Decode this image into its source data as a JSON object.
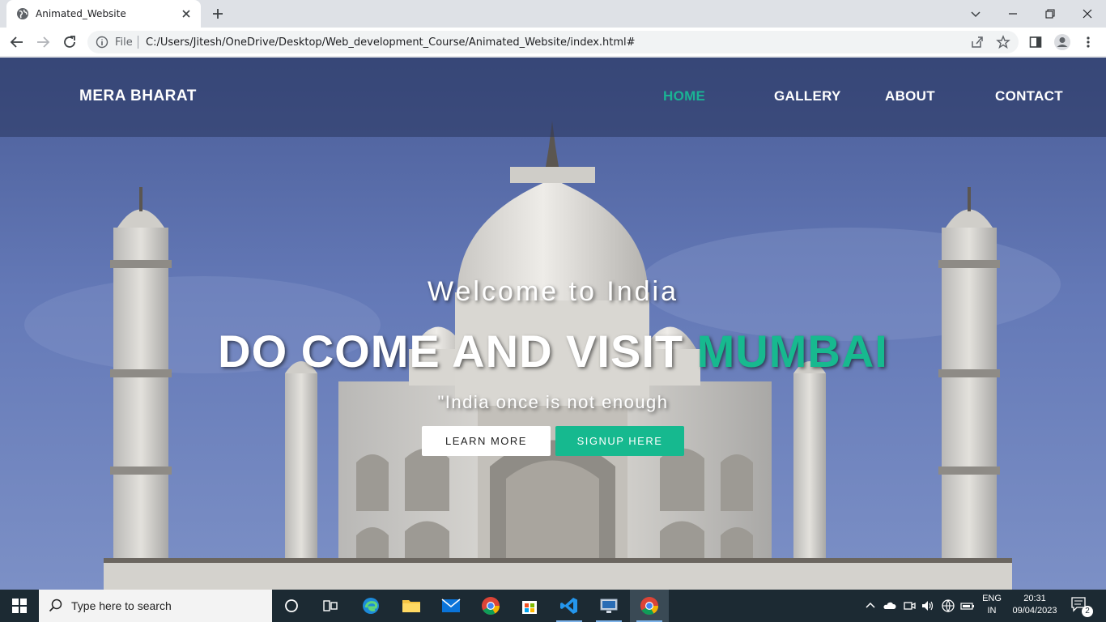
{
  "browser": {
    "tab_title": "Animated_Website",
    "omnibox_scheme_label": "File",
    "url": "C:/Users/Jitesh/OneDrive/Desktop/Web_development_Course/Animated_Website/index.html#"
  },
  "page": {
    "logo": "MERA BHARAT",
    "nav": [
      {
        "label": "HOME",
        "active": true
      },
      {
        "label": "GALLERY",
        "active": false
      },
      {
        "label": "ABOUT",
        "active": false
      },
      {
        "label": "CONTACT",
        "active": false
      }
    ],
    "hero": {
      "welcome": "Welcome to India",
      "heading_prefix": "DO COME AND VISIT",
      "heading_highlight": "MUMBAI",
      "quote": "\"India once is not enough",
      "learn_more": "LEARN MORE",
      "signup": "SIGNUP HERE"
    },
    "colors": {
      "accent": "#17b98f",
      "navbar": "rgba(40,52,92,0.55)"
    }
  },
  "taskbar": {
    "search_placeholder": "Type here to search",
    "apps": [
      "cortana-icon",
      "task-view-icon",
      "edge-icon",
      "file-explorer-icon",
      "mail-icon",
      "chrome-icon",
      "store-icon",
      "vscode-icon",
      "remote-desktop-icon",
      "chrome-active-icon"
    ],
    "lang_top": "ENG",
    "lang_bottom": "IN",
    "time": "20:31",
    "date": "09/04/2023",
    "notification_count": "2"
  }
}
